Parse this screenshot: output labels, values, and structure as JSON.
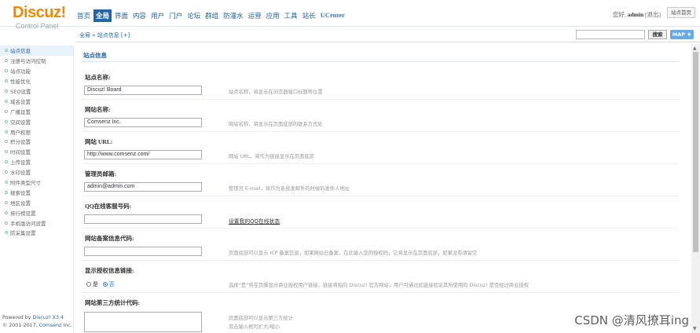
{
  "logo": {
    "text": "Discuz!",
    "subtitle": "Control Panel"
  },
  "topnav": [
    "首页",
    "全局",
    "界面",
    "内容",
    "用户",
    "门户",
    "论坛",
    "群组",
    "防灌水",
    "运营",
    "应用",
    "工具",
    "站长",
    "UCenter"
  ],
  "user": {
    "greeting": "您好,",
    "name": "admin",
    "logout": "[退出]",
    "home_button": "站点首页"
  },
  "breadcrumb": "全局 » 站点信息  [+]",
  "search": {
    "button": "搜索",
    "map": "MAP ♦"
  },
  "sidebar": {
    "items": [
      "站点信息",
      "注册与访问控制",
      "站点功能",
      "性能优化",
      "SEO设置",
      "域名设置",
      "广播设置",
      "空间设置",
      "用户权限",
      "积分设置",
      "时间设置",
      "上传设置",
      "水印设置",
      "附件类型尺寸",
      "搜索设置",
      "地区设置",
      "排行榜设置",
      "手机版访问设置",
      "防采集设置"
    ],
    "powered_label": "Powered by ",
    "powered_version": "Discuz! X3.4",
    "copyright_years": "© 2001-2017, ",
    "copyright_company": "Comsenz Inc."
  },
  "main": {
    "title": "站点信息",
    "fields": [
      {
        "label": "站点名称:",
        "value": "Discuz! Board",
        "desc": "站点名称，将显示在浏览器窗口标题等位置"
      },
      {
        "label": "网站名称:",
        "value": "Comsenz Inc.",
        "desc": "网站名称，将显示在页面底部的联系方式处"
      },
      {
        "label": "网站 URL:",
        "value": "http://www.comsenz.com/",
        "desc": "网站 URL，将作为链接显示在页面底部"
      },
      {
        "label": "管理员邮箱:",
        "value": "admin@admin.com",
        "desc": "管理员 E-mail，将作为系统发邮件的时候的发件人地址"
      },
      {
        "label": "QQ在线客服号码:",
        "value": "",
        "desc": "设置我的QQ在线状态"
      },
      {
        "label": "网站备案信息代码:",
        "value": "",
        "desc": "页面底部可以显示 ICP 备案信息，如果网站已备案，在此输入您的授权码，它将显示在页面底部，如果没有请留空"
      }
    ],
    "license_label": "显示授权信息链接:",
    "radio_no": "是",
    "radio_yes": "否",
    "license_desc": "选择“是”将在页脚显示商业授权用户链接，链接将指向 Discuz! 官方网站，用户可通过此链接验证其所使用的 Discuz! 是否经过商业授权",
    "stats_label": "网站第三方统计代码:",
    "stats_desc1": "页面底部可以显示第三方统计",
    "stats_desc2": "双击输入框可扩大/缩小"
  },
  "watermark": "CSDN @清风撩耳ing"
}
